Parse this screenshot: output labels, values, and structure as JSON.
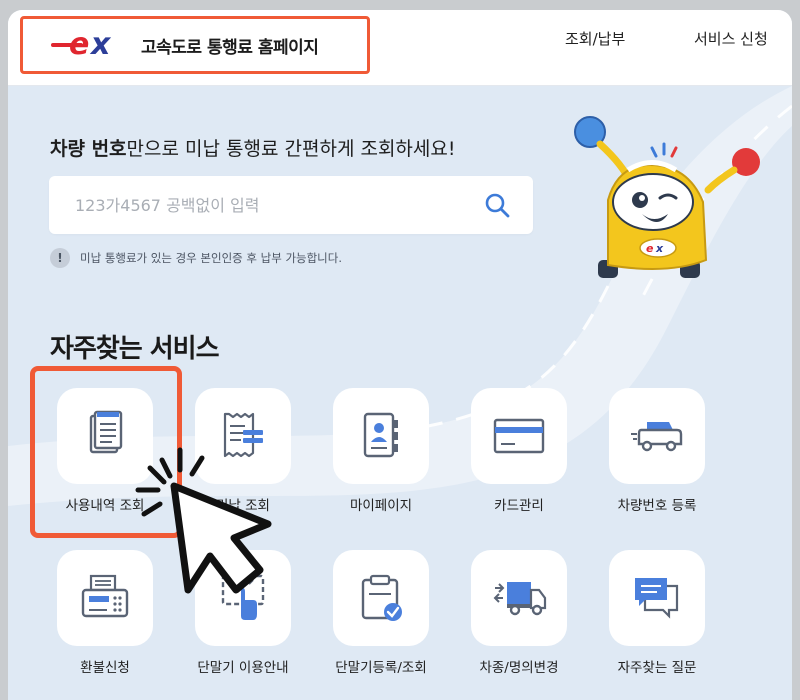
{
  "header": {
    "brand_title": "고속도로 통행료 홈페이지",
    "logo_text": "ex",
    "nav": [
      "조회/납부",
      "서비스 신청"
    ]
  },
  "search": {
    "headline_bold": "차량 번호",
    "headline_rest": "만으로 미납 통행료 간편하게 조회하세요!",
    "placeholder": "123가4567 공백없이 입력",
    "notice_icon": "!",
    "notice": "미납 통행료가 있는 경우 본인인증 후 납부 가능합니다."
  },
  "services": {
    "title": "자주찾는 서비스",
    "items": [
      {
        "label": "사용내역 조회",
        "icon": "document-list-icon"
      },
      {
        "label": "미납 조회",
        "icon": "receipt-icon"
      },
      {
        "label": "마이페이지",
        "icon": "id-card-icon"
      },
      {
        "label": "카드관리",
        "icon": "credit-card-icon"
      },
      {
        "label": "차량번호 등록",
        "icon": "car-icon"
      },
      {
        "label": "환불신청",
        "icon": "fax-machine-icon"
      },
      {
        "label": "단말기 이용안내",
        "icon": "touch-screen-icon"
      },
      {
        "label": "단말기등록/조회",
        "icon": "clipboard-check-icon"
      },
      {
        "label": "차종/명의변경",
        "icon": "truck-icon"
      },
      {
        "label": "자주찾는 질문",
        "icon": "chat-bubble-icon"
      }
    ]
  },
  "colors": {
    "accent_red": "#f05a36",
    "icon_blue": "#4a7fdc",
    "icon_gray": "#5a6475",
    "background": "#dfe9f4"
  }
}
